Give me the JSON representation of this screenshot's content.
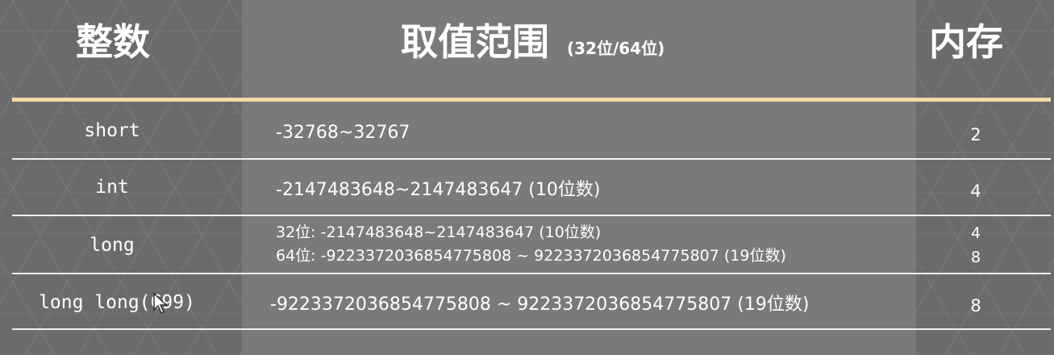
{
  "headers": {
    "integer": "整数",
    "range": "取值范围",
    "range_note": "(32位/64位)",
    "memory": "内存"
  },
  "rows": [
    {
      "type": "short",
      "range": "-32768~32767",
      "memory": "2"
    },
    {
      "type": "int",
      "range": "-2147483648~2147483647 (10位数)",
      "memory": "4"
    },
    {
      "type": "long",
      "range_32": "32位: -2147483648~2147483647 (10位数)",
      "range_64": "64位: -9223372036854775808 ~ 9223372036854775807 (19位数)",
      "memory_32": "4",
      "memory_64": "8"
    },
    {
      "type": "long long(C99)",
      "range": "-9223372036854775808 ~ 9223372036854775807 (19位数)",
      "memory": "8"
    }
  ],
  "colors": {
    "header_rule": "#f2d9a6",
    "row_rule": "#f0f0f0",
    "middle_column": "#7a7a7a",
    "side_columns": "#6b6b6b"
  }
}
